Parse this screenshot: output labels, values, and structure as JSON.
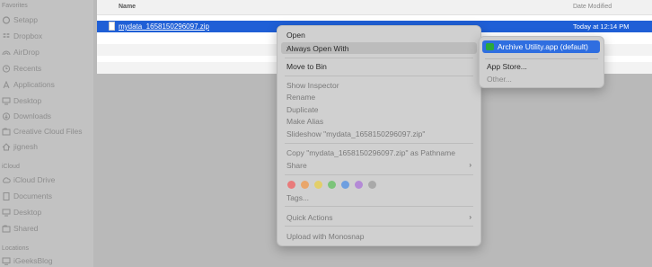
{
  "sidebar": {
    "favorites_label": "Favorites",
    "icloud_label": "iCloud",
    "locations_label": "Locations",
    "favorites": [
      {
        "label": "Setapp",
        "icon": "setapp-icon"
      },
      {
        "label": "Dropbox",
        "icon": "dropbox-icon"
      },
      {
        "label": "AirDrop",
        "icon": "airdrop-icon"
      },
      {
        "label": "Recents",
        "icon": "clock-icon"
      },
      {
        "label": "Applications",
        "icon": "applications-icon"
      },
      {
        "label": "Desktop",
        "icon": "desktop-icon"
      },
      {
        "label": "Downloads",
        "icon": "downloads-icon"
      },
      {
        "label": "Creative Cloud Files",
        "icon": "creative-cloud-icon"
      },
      {
        "label": "jignesh",
        "icon": "home-icon"
      }
    ],
    "icloud": [
      {
        "label": "iCloud Drive",
        "icon": "cloud-icon"
      },
      {
        "label": "Documents",
        "icon": "document-icon"
      },
      {
        "label": "Desktop",
        "icon": "desktop-icon"
      },
      {
        "label": "Shared",
        "icon": "shared-folder-icon"
      }
    ],
    "locations": [
      {
        "label": "iGeeksBlog",
        "icon": "computer-icon"
      }
    ]
  },
  "filelist": {
    "col_name": "Name",
    "col_date": "Date Modified",
    "selected_file": {
      "name": "mydata_1658150296097.zip",
      "date": "Today at 12:14 PM"
    }
  },
  "context_menu": {
    "open": "Open",
    "always_open_with": "Always Open With",
    "move_to_bin": "Move to Bin",
    "show_inspector": "Show Inspector",
    "rename": "Rename",
    "duplicate": "Duplicate",
    "make_alias": "Make Alias",
    "slideshow": "Slideshow \"mydata_1658150296097.zip\"",
    "copy_pathname": "Copy \"mydata_1658150296097.zip\" as Pathname",
    "share": "Share",
    "tags": "Tags...",
    "quick_actions": "Quick Actions",
    "upload": "Upload with Monosnap",
    "tag_colors": [
      "#e97b7b",
      "#e9a66b",
      "#e3cf6a",
      "#7cc47a",
      "#6e9fe0",
      "#b48ad6",
      "#a9a9a9"
    ]
  },
  "submenu": {
    "default_app": "Archive Utility.app (default)",
    "app_store": "App Store...",
    "other": "Other..."
  },
  "colors": {
    "selection": "#1f5fd6",
    "submenu_selection": "#2f6ee0",
    "archive_icon": "#2aa83a"
  }
}
